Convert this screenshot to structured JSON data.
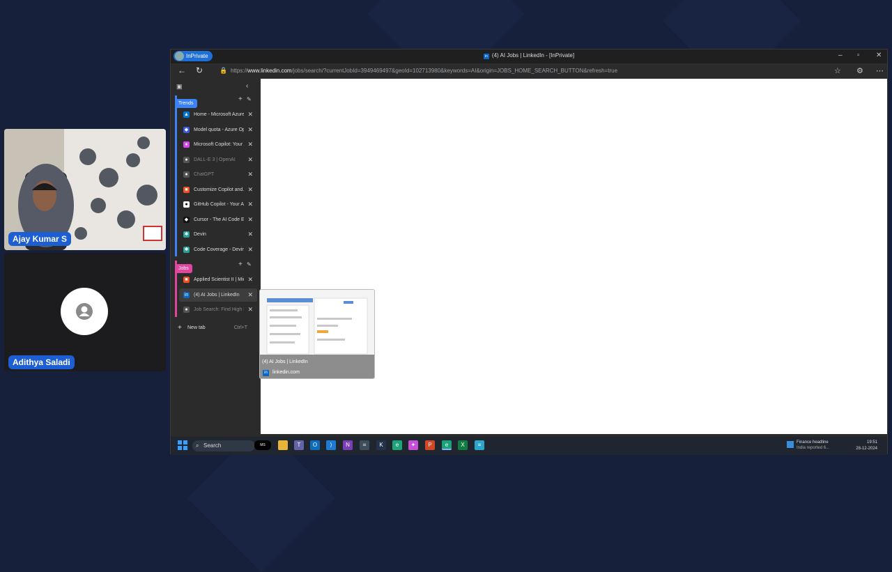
{
  "participants": [
    {
      "name": "Ajay Kumar S",
      "video": true
    },
    {
      "name": "Adithya Saladi",
      "video": false
    }
  ],
  "browser": {
    "inprivate_label": "InPrivate",
    "window_title": "(4) AI Jobs | LinkedIn - [InPrivate]",
    "url_prefix": "https://",
    "url_host": "www.linkedin.com",
    "url_rest": "/jobs/search/?currentJobId=3949469497&geoId=102713980&keywords=AI&origin=JOBS_HOME_SEARCH_BUTTON&refresh=true"
  },
  "tab_groups": [
    {
      "name": "Trends",
      "color": "#3b82f6",
      "tabs": [
        {
          "title": "Home - Microsoft Azure",
          "icon": "azure-icon",
          "color": "#0078d4",
          "glyph": "▲",
          "dim": false
        },
        {
          "title": "Model quota - Azure OpenAI",
          "icon": "azure-openai-icon",
          "color": "#3b5bdb",
          "glyph": "◆",
          "dim": false
        },
        {
          "title": "Microsoft Copilot: Your AI companion",
          "icon": "copilot-icon",
          "color": "#d946ef",
          "glyph": "●",
          "dim": false
        },
        {
          "title": "DALL-E 3 | OpenAI",
          "icon": "openai-icon",
          "color": "#555555",
          "glyph": "●",
          "dim": true
        },
        {
          "title": "ChatGPT",
          "icon": "chatgpt-icon",
          "color": "#555555",
          "glyph": "●",
          "dim": true
        },
        {
          "title": "Customize Copilot and...",
          "icon": "microsoft-icon",
          "color": "#f25022",
          "glyph": "■",
          "dim": false
        },
        {
          "title": "GitHub Copilot - Your AI pair programmer",
          "icon": "github-icon",
          "color": "#ffffff",
          "glyph": "●",
          "dim": false
        },
        {
          "title": "Cursor - The AI Code Editor",
          "icon": "cursor-icon",
          "color": "#111111",
          "glyph": "◆",
          "dim": false
        },
        {
          "title": "Devin",
          "icon": "devin-icon",
          "color": "#2aa198",
          "glyph": "✱",
          "dim": false
        },
        {
          "title": "Code Coverage - Devin",
          "icon": "devin-docs-icon",
          "color": "#2aa198",
          "glyph": "✱",
          "dim": false
        }
      ]
    },
    {
      "name": "Jobs",
      "color": "#e0469e",
      "tabs": [
        {
          "title": "Applied Scientist II | Microsoft Careers",
          "icon": "microsoft-icon",
          "color": "#f25022",
          "glyph": "■",
          "dim": false
        },
        {
          "title": "(4) AI Jobs | LinkedIn",
          "icon": "linkedin-icon",
          "color": "#0a66c2",
          "glyph": "in",
          "dim": false,
          "active": true
        },
        {
          "title": "Job Search: Find High Paying Jobs",
          "icon": "job-search-icon",
          "color": "#555555",
          "glyph": "●",
          "dim": true
        }
      ]
    }
  ],
  "new_tab": {
    "label": "New tab",
    "shortcut": "Ctrl+T"
  },
  "preview": {
    "title": "(4) AI Jobs | LinkedIn",
    "domain": "linkedin.com"
  },
  "taskbar": {
    "search_label": "Search",
    "news_title": "Finance headline",
    "news_sub": "India reported 6...",
    "time": "19:51",
    "date": "28-12-2024"
  }
}
